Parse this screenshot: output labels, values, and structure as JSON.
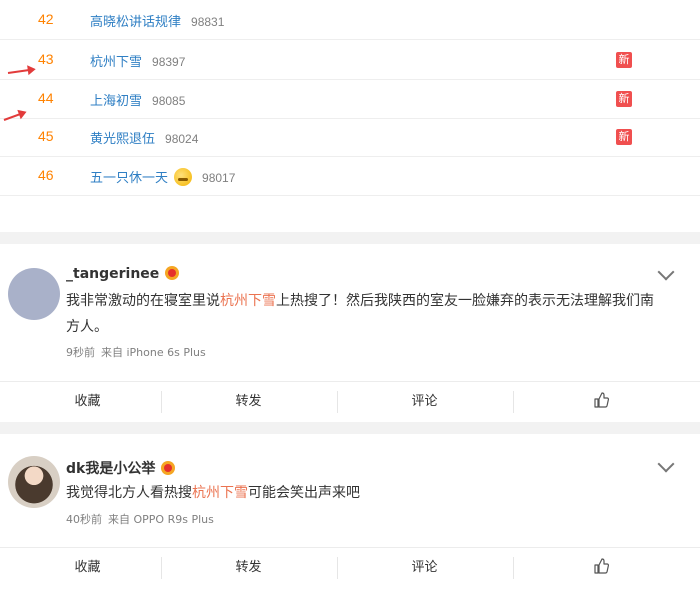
{
  "hot_search": {
    "items": [
      {
        "rank": "42",
        "topic": "高晓松讲话规律",
        "count": "98831",
        "badge": ""
      },
      {
        "rank": "43",
        "topic": "杭州下雪",
        "count": "98397",
        "badge": "新"
      },
      {
        "rank": "44",
        "topic": "上海初雪",
        "count": "98085",
        "badge": "新"
      },
      {
        "rank": "45",
        "topic": "黄光熙退伍",
        "count": "98024",
        "badge": "新"
      },
      {
        "rank": "46",
        "topic": "五一只休一天",
        "count": "98017",
        "badge": ""
      }
    ]
  },
  "posts": [
    {
      "username": "_tangerinee",
      "content_before": "我非常激动的在寝室里说",
      "content_highlight": "杭州下雪",
      "content_after": "上热搜了！然后我陕西的室友一脸嫌弃的表示无法理解我们南方人。",
      "time": "9秒前",
      "source": "来自 iPhone 6s Plus"
    },
    {
      "username": "dk我是小公举",
      "content_before": "我觉得北方人看热搜",
      "content_highlight": "杭州下雪",
      "content_after": "可能会笑出声来吧",
      "time": "40秒前",
      "source": "来自 OPPO R9s Plus"
    }
  ],
  "actions": {
    "favorite": "收藏",
    "repost": "转发",
    "comment": "评论"
  },
  "colors": {
    "rank": "#ff8200",
    "topic": "#2f7fc4",
    "highlight": "#eb7350",
    "new_badge": "#f04f4f",
    "annotation_arrow": "#e23b3b"
  },
  "icons": [
    "emoji-icon",
    "vip-badge-icon",
    "chevron-down-icon",
    "like-thumb-icon",
    "red-arrow-annotation"
  ]
}
